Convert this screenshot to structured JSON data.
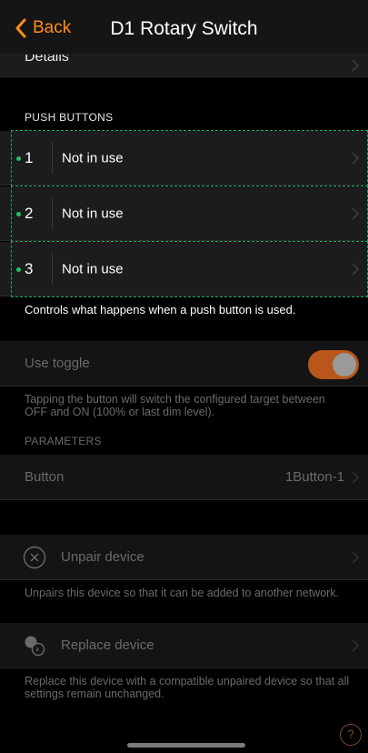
{
  "nav": {
    "back_label": "Back",
    "title": "D1 Rotary Switch"
  },
  "details_label": "Details",
  "push_buttons": {
    "header": "PUSH BUTTONS",
    "items": [
      {
        "number": "1",
        "label": "Not in use"
      },
      {
        "number": "2",
        "label": "Not in use"
      },
      {
        "number": "3",
        "label": "Not in use"
      }
    ],
    "footer": "Controls what happens when a push button is used."
  },
  "use_toggle": {
    "label": "Use toggle",
    "enabled": true,
    "note": "Tapping the button will switch the configured target between OFF and ON (100% or last dim level)."
  },
  "parameters": {
    "header": "PARAMETERS",
    "button_label": "Button",
    "button_value": "1Button-1"
  },
  "unpair": {
    "label": "Unpair device",
    "note": "Unpairs this device so that it can be added to another network."
  },
  "replace": {
    "label": "Replace device",
    "note": "Replace this device with a compatible unpaired device so that all settings remain unchanged."
  },
  "help_label": "?",
  "colors": {
    "accent": "#ff8c16",
    "indicator": "#1ec26b",
    "toggle_on": "#b8561c"
  }
}
